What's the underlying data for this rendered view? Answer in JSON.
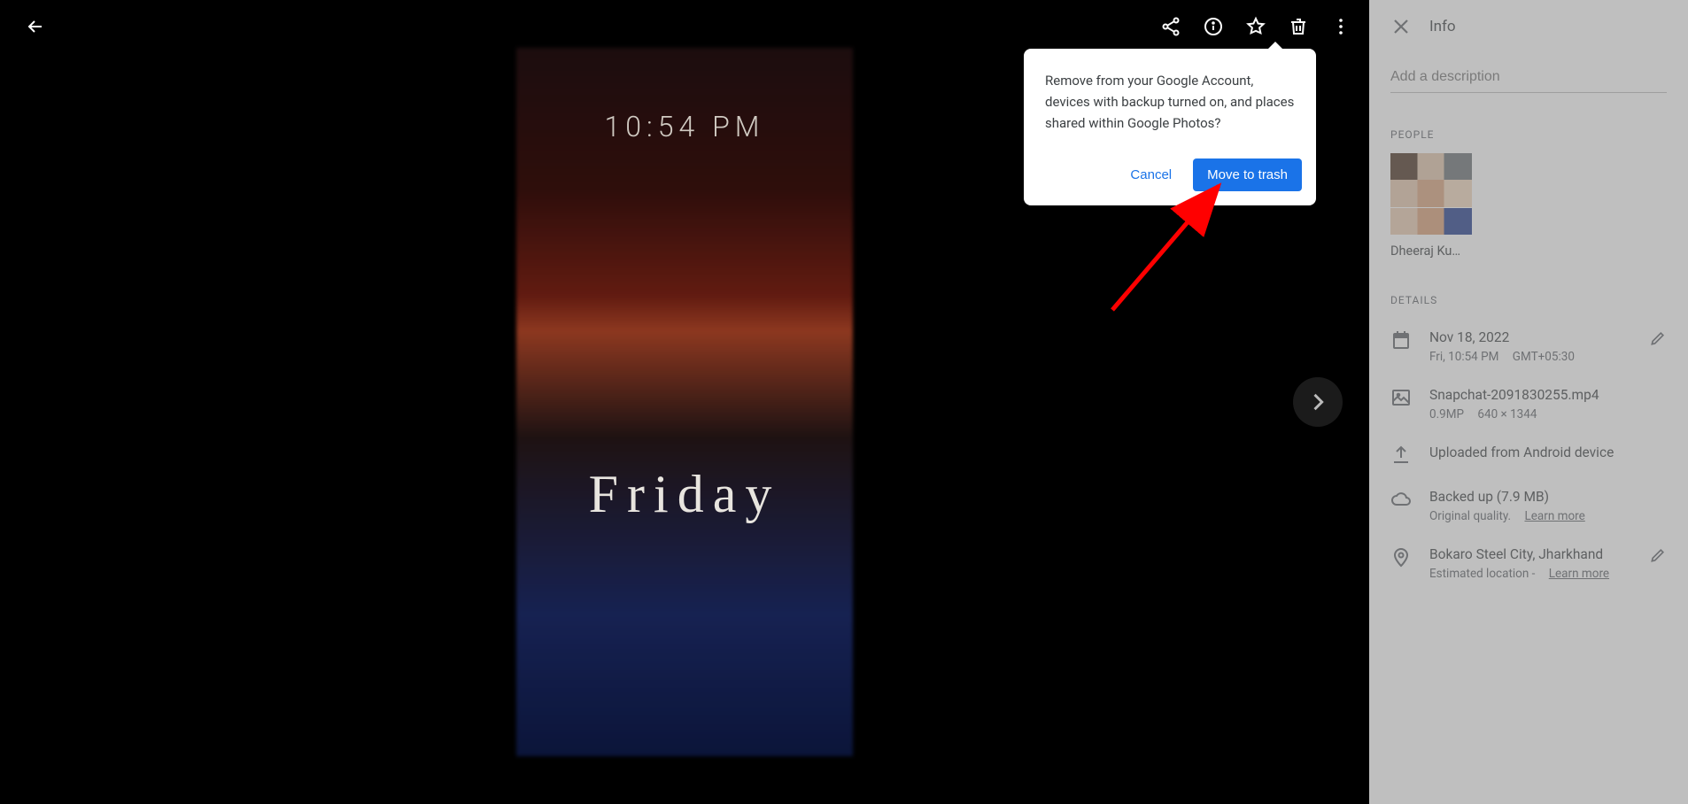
{
  "viewer": {
    "photo_time_overlay": "10:54 PM",
    "photo_day_overlay": "Friday"
  },
  "dialog": {
    "message": "Remove from your Google Account, devices with backup turned on, and places shared within Google Photos?",
    "cancel_label": "Cancel",
    "confirm_label": "Move to trash"
  },
  "info": {
    "title": "Info",
    "description_placeholder": "Add a description",
    "people_label": "PEOPLE",
    "person_name": "Dheeraj Ku…",
    "details_label": "DETAILS",
    "date": {
      "value": "Nov 18, 2022",
      "day_time": "Fri, 10:54 PM",
      "tz": "GMT+05:30"
    },
    "file": {
      "name": "Snapchat-2091830255.mp4",
      "mp": "0.9MP",
      "dims": "640 × 1344"
    },
    "upload": "Uploaded from Android device",
    "backup": {
      "title": "Backed up (7.9 MB)",
      "quality": "Original quality.",
      "learn_more": "Learn more"
    },
    "location": {
      "place": "Bokaro Steel City, Jharkhand",
      "estimate": "Estimated location -",
      "learn_more": "Learn more"
    }
  }
}
